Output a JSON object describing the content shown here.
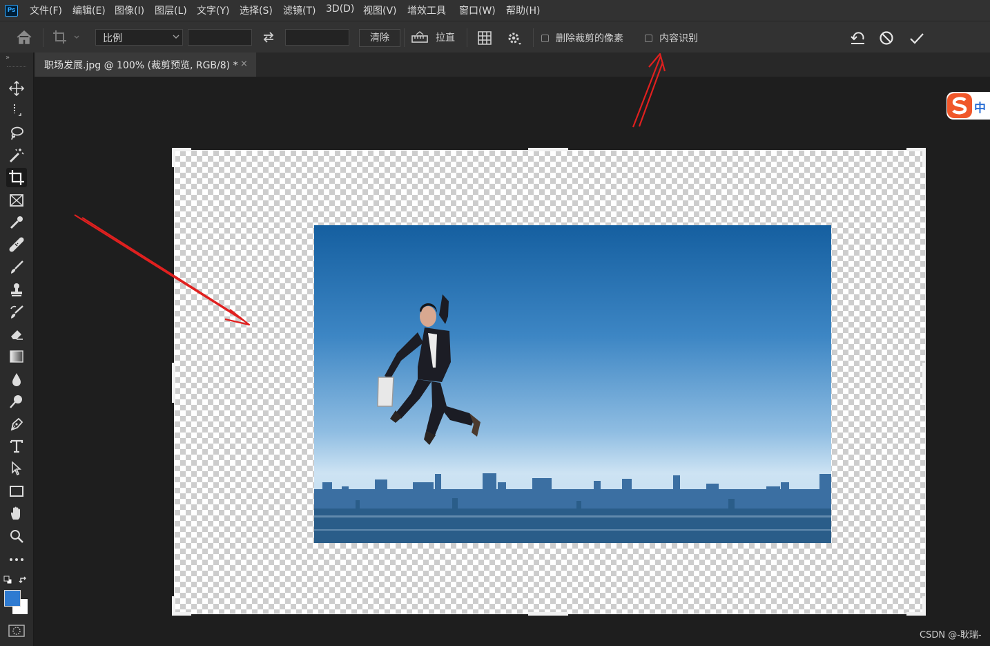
{
  "app": {
    "logo": "Ps"
  },
  "menu": [
    "文件(F)",
    "编辑(E)",
    "图像(I)",
    "图层(L)",
    "文字(Y)",
    "选择(S)",
    "滤镜(T)",
    "3D(D)",
    "视图(V)",
    "增效工具",
    "窗口(W)",
    "帮助(H)"
  ],
  "options": {
    "ratio_select": "比例",
    "clear_button": "清除",
    "straighten_label": "拉直",
    "delete_cropped_label": "删除裁剪的像素",
    "delete_cropped_checked": false,
    "content_aware_label": "内容识别",
    "content_aware_checked": false
  },
  "document": {
    "tab_title": "职场发展.jpg @ 100% (裁剪预览, RGB/8) *",
    "tab_close": "×"
  },
  "ime": {
    "label": "中"
  },
  "watermark": "CSDN @-耿瑞-",
  "colors": {
    "foreground": "#2f7bd1",
    "background": "#ffffff",
    "annotation_arrow": "#e0201f"
  },
  "tools": [
    "move-icon",
    "marquee-icon",
    "lasso-icon",
    "magic-wand-icon",
    "crop-icon",
    "frame-icon",
    "eyedropper-icon",
    "healing-icon",
    "brush-icon",
    "stamp-icon",
    "history-brush-icon",
    "eraser-icon",
    "gradient-icon",
    "blur-icon",
    "dodge-icon",
    "pen-icon",
    "type-icon",
    "path-select-icon",
    "rectangle-icon",
    "hand-icon",
    "zoom-icon",
    "more-icon"
  ]
}
